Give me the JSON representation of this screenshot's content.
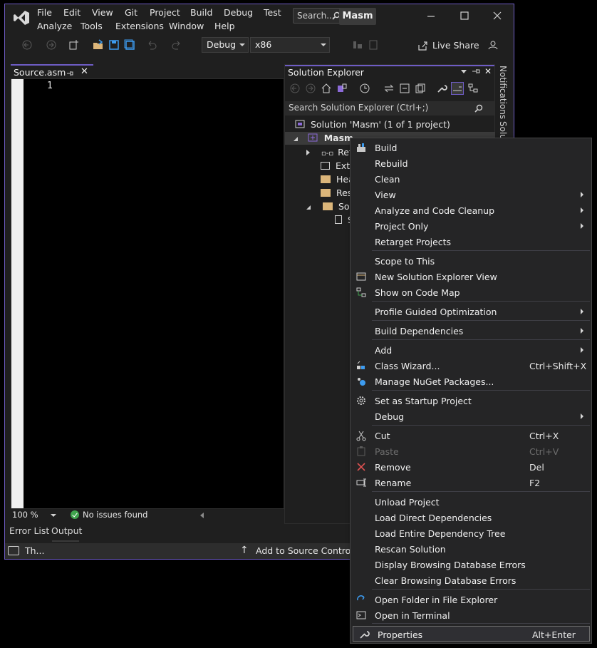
{
  "title_bar": {
    "menus_row1": [
      "File",
      "Edit",
      "View",
      "Git",
      "Project",
      "Build",
      "Debug",
      "Test"
    ],
    "menus_row2": [
      "Analyze",
      "Tools",
      "Extensions",
      "Window",
      "Help"
    ],
    "search_label": "Search...",
    "project_badge": "Masm"
  },
  "toolbar": {
    "config": "Debug",
    "platform": "x86",
    "live_share": "Live Share"
  },
  "editor": {
    "tab_label": "Source.asm",
    "line_number": "1",
    "zoom": "100 %",
    "issues": "No issues found"
  },
  "bottom_tabs": [
    "Error List",
    "Output"
  ],
  "status_bar": {
    "message": "Th...",
    "add_to_source": "Add to Source Control"
  },
  "solution_explorer": {
    "title": "Solution Explorer",
    "search_placeholder": "Search Solution Explorer (Ctrl+;)",
    "solution_row": "Solution 'Masm'   (1 of 1 project)",
    "project_row": "Masm",
    "tree": [
      "Refe",
      "Exte",
      "Hea",
      "Reso",
      "Sou",
      "S"
    ]
  },
  "side_tabs": [
    "Notifications",
    "Solu"
  ],
  "context_menu": {
    "items": [
      {
        "label": "Build",
        "icon": "build-icon"
      },
      {
        "label": "Rebuild"
      },
      {
        "label": "Clean"
      },
      {
        "label": "View",
        "submenu": true
      },
      {
        "label": "Analyze and Code Cleanup",
        "submenu": true
      },
      {
        "label": "Project Only",
        "submenu": true
      },
      {
        "label": "Retarget Projects"
      },
      {
        "label": "Scope to This"
      },
      {
        "label": "New Solution Explorer View",
        "icon": "new-view-icon"
      },
      {
        "label": "Show on Code Map",
        "icon": "code-map-icon"
      },
      {
        "label": "Profile Guided Optimization",
        "submenu": true
      },
      {
        "label": "Build Dependencies",
        "submenu": true
      },
      {
        "label": "Add",
        "submenu": true
      },
      {
        "label": "Class Wizard...",
        "shortcut": "Ctrl+Shift+X",
        "icon": "class-wizard-icon"
      },
      {
        "label": "Manage NuGet Packages...",
        "icon": "nuget-icon"
      },
      {
        "label": "Set as Startup Project",
        "icon": "gear-icon"
      },
      {
        "label": "Debug",
        "submenu": true
      },
      {
        "label": "Cut",
        "shortcut": "Ctrl+X",
        "icon": "scissors-icon"
      },
      {
        "label": "Paste",
        "shortcut": "Ctrl+V",
        "icon": "paste-icon",
        "disabled": true
      },
      {
        "label": "Remove",
        "shortcut": "Del",
        "icon": "remove-icon"
      },
      {
        "label": "Rename",
        "shortcut": "F2",
        "icon": "rename-icon"
      },
      {
        "label": "Unload Project"
      },
      {
        "label": "Load Direct Dependencies"
      },
      {
        "label": "Load Entire Dependency Tree"
      },
      {
        "label": "Rescan Solution"
      },
      {
        "label": "Display Browsing Database Errors"
      },
      {
        "label": "Clear Browsing Database Errors"
      },
      {
        "label": "Open Folder in File Explorer",
        "icon": "open-folder-icon"
      },
      {
        "label": "Open in Terminal",
        "icon": "terminal-icon"
      },
      {
        "label": "Properties",
        "shortcut": "Alt+Enter",
        "icon": "wrench-icon",
        "highlighted": true
      }
    ]
  },
  "colors": {
    "accent": "#6e5cc4",
    "background": "#1f1f1f",
    "menu_bg": "#252526",
    "remove_red": "#e05252",
    "nuget_blue": "#3d9cf0"
  }
}
